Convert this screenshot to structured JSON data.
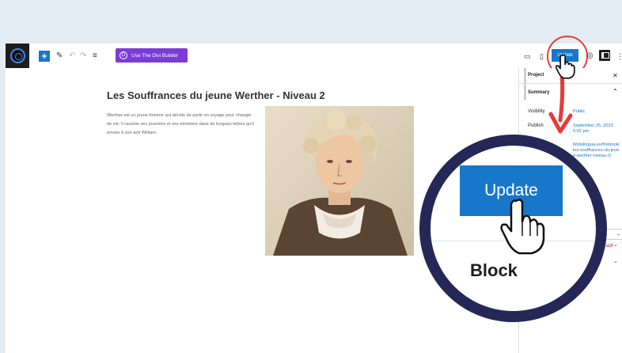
{
  "toolbar": {
    "divi_label": "Use The Divi Builder",
    "divi_icon_letter": "D",
    "update_label": "Update"
  },
  "post": {
    "title": "Les Souffrances du jeune Werther - Niveau 2",
    "excerpt": "Werther est un jeune homme qui décide de partir en voyage pour changer de vie. Il raconte ses journées et ses émotions dans de longues lettres qu'il envoie à son ami William."
  },
  "sidebar": {
    "tab_project": "Project",
    "section_summary": "Summary",
    "visibility_label": "Visibility",
    "visibility_value": "Public",
    "publish_label": "Publish",
    "publish_value": "September 25, 2023 5:02 pm",
    "url_value": "bibliolingua.eu/fr/ebook/les-souffrances-du-jeune-werther-niveau-2/",
    "trash_label": "o trash"
  },
  "zoom": {
    "update_label": "Update",
    "block_label": "Block"
  },
  "colors": {
    "accent": "#1778c9",
    "divi": "#7b3bd7",
    "highlight": "#e63b3b",
    "bubble_border": "#252856"
  }
}
